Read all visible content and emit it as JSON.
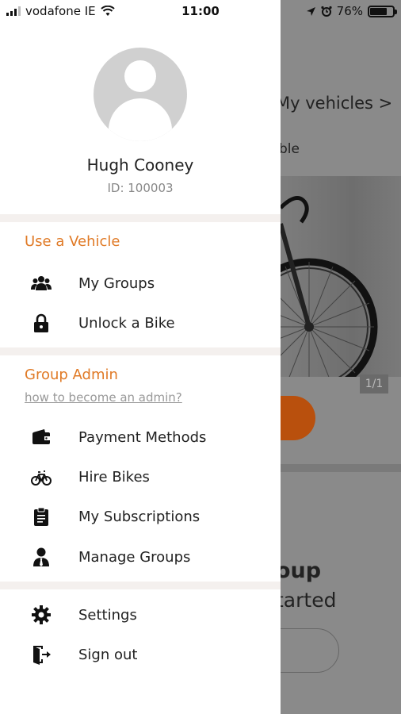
{
  "status_bar": {
    "carrier": "vodafone IE",
    "time": "11:00",
    "battery_percent": "76%",
    "battery_level": 0.76,
    "icons": [
      "signal-icon",
      "wifi-icon",
      "location-arrow-icon",
      "alarm-icon",
      "battery-icon"
    ]
  },
  "user": {
    "name": "Hugh Cooney",
    "id_text": "ID: 100003"
  },
  "sections": {
    "use_vehicle": {
      "title": "Use a Vehicle",
      "items": [
        {
          "label": "My Groups",
          "icon": "users-group-icon"
        },
        {
          "label": "Unlock a Bike",
          "icon": "lock-icon"
        }
      ]
    },
    "group_admin": {
      "title": "Group Admin",
      "link": "how to become an admin?",
      "items": [
        {
          "label": "Payment Methods",
          "icon": "wallet-icon"
        },
        {
          "label": "Hire Bikes",
          "icon": "bicycle-icon"
        },
        {
          "label": "My Subscriptions",
          "icon": "clipboard-icon"
        },
        {
          "label": "Manage Groups",
          "icon": "user-tie-icon"
        }
      ]
    },
    "footer": {
      "items": [
        {
          "label": "Settings",
          "icon": "gear-icon"
        },
        {
          "label": "Sign out",
          "icon": "sign-out-icon"
        }
      ]
    }
  },
  "background": {
    "my_vehicles": "My vehicles >",
    "available_partial": "ble",
    "photo_counter": "1/1",
    "group_title_partial": "oup",
    "get_started_partial": "tarted"
  },
  "colors": {
    "accent": "#e07a26",
    "separator": "#f4f0ee",
    "overlay": "#8a8a8a"
  }
}
